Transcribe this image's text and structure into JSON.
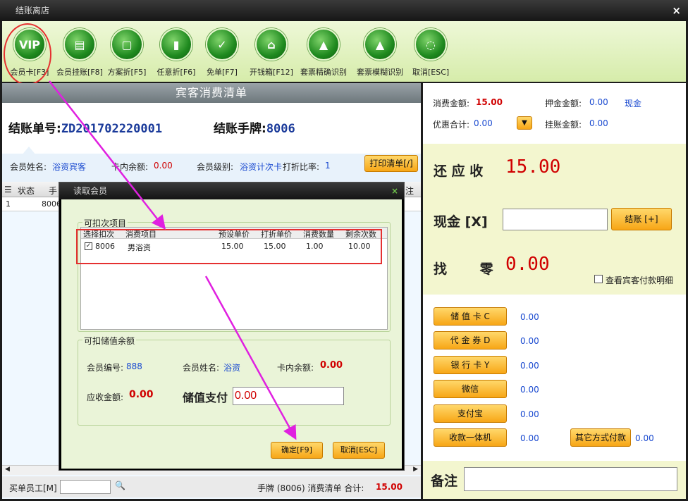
{
  "window": {
    "title": "结账离店",
    "close": "×"
  },
  "toolbar": [
    {
      "label": "会员卡[F3]",
      "icon": "vip-card-icon",
      "glyph": "VIP"
    },
    {
      "label": "会员挂账[F8]",
      "icon": "member-bill-icon",
      "glyph": "▤"
    },
    {
      "label": "方案折[F5]",
      "icon": "plan-discount-icon",
      "glyph": "▢"
    },
    {
      "label": "任意折[F6]",
      "icon": "any-discount-icon",
      "glyph": "▮"
    },
    {
      "label": "免单[F7]",
      "icon": "free-order-icon",
      "glyph": "✓"
    },
    {
      "label": "开钱箱[F12]",
      "icon": "cash-box-icon",
      "glyph": "⌂"
    },
    {
      "label": "套票精确识别",
      "icon": "ticket-exact-icon",
      "glyph": "▲"
    },
    {
      "label": "套票模糊识别",
      "icon": "ticket-fuzzy-icon",
      "glyph": "▲"
    },
    {
      "label": "取消[ESC]",
      "icon": "cancel-icon",
      "glyph": "◌"
    }
  ],
  "bill": {
    "header": "宾客消费清单",
    "no_label": "结账单号:",
    "no_value": "ZD201702220001",
    "tag_label": "结账手牌:",
    "tag_value": "8006",
    "member_name_label": "会员姓名:",
    "member_name": "浴资宾客",
    "card_balance_label": "卡内余额:",
    "card_balance": "0.00",
    "member_level_label": "会员级别:",
    "member_level": "浴资计次卡",
    "discount_label": "打折比率:",
    "discount": "1",
    "print_button": "打印清单[/]",
    "grid_headers": [
      "状态",
      "手",
      "注证"
    ],
    "row": [
      "1",
      "8006"
    ]
  },
  "footer": {
    "staff_label": "买单员工[M]",
    "summary_prefix": "手牌 (8006) 消费清单 合计:",
    "total": "15.00"
  },
  "right": {
    "consume_label": "消费金额:",
    "consume": "15.00",
    "deposit_label": "押金金额:",
    "deposit": "0.00",
    "deposit_type": "现金",
    "discount_total_label": "优惠合计:",
    "discount_total": "0.00",
    "credit_label": "挂账金额:",
    "credit": "0.00",
    "receivable_label": "还 应 收",
    "receivable": "15.00",
    "cash_label": "现金 [X]",
    "settle_button": "结账 [+]",
    "change_label": "找 零",
    "change": "0.00",
    "show_detail": "查看宾客付款明细",
    "pay_methods": [
      {
        "label": "储 值 卡 C",
        "value": "0.00"
      },
      {
        "label": "代 金 券 D",
        "value": "0.00"
      },
      {
        "label": "银 行 卡 Y",
        "value": "0.00"
      },
      {
        "label": "微信",
        "value": "0.00"
      },
      {
        "label": "支付宝",
        "value": "0.00"
      },
      {
        "label": "收款一体机",
        "value": "0.00"
      }
    ],
    "other_pay": "其它方式付款",
    "other_pay_value": "0.00",
    "note_label": "备注"
  },
  "dialog": {
    "title": "读取会员",
    "close": "×",
    "group1": "可扣次项目",
    "cols": [
      "选择扣次",
      "消费项目",
      "预设单价",
      "打折单价",
      "消费数量",
      "剩余次数"
    ],
    "row": {
      "code": "8006",
      "item": "男浴资",
      "preset": "15.00",
      "discount": "15.00",
      "qty": "1.00",
      "remain": "10.00"
    },
    "group2": "可扣储值余额",
    "member_no_label": "会员编号:",
    "member_no": "888",
    "member_name_label": "会员姓名:",
    "member_name": "浴资",
    "balance_label": "卡内余额:",
    "balance": "0.00",
    "due_label": "应收金额:",
    "due": "0.00",
    "stored_pay_label": "储值支付",
    "stored_pay": "0.00",
    "ok_button": "确定[F9]",
    "cancel_button": "取消[ESC]"
  }
}
